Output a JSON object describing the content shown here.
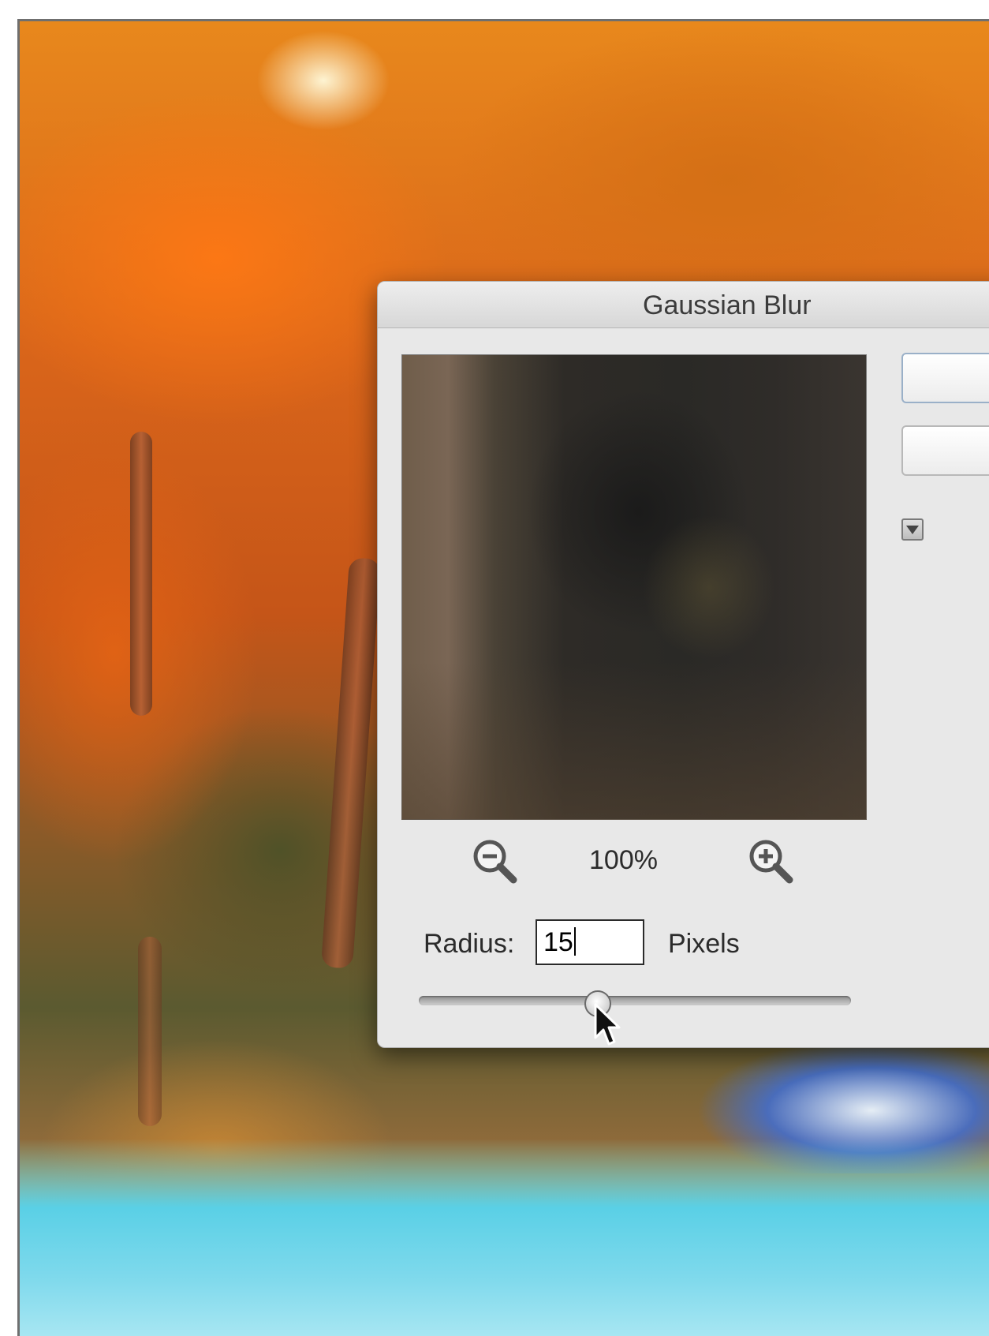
{
  "dialog": {
    "title": "Gaussian Blur",
    "zoom_level": "100%",
    "radius_label": "Radius:",
    "radius_value": "15",
    "radius_unit": "Pixels"
  },
  "icons": {
    "zoom_out": "zoom-out-icon",
    "zoom_in": "zoom-in-icon",
    "cursor": "arrow-cursor-icon"
  }
}
